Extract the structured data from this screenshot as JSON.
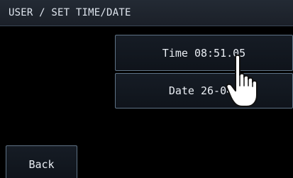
{
  "header": {
    "title": "USER / SET TIME/DATE"
  },
  "buttons": {
    "time_label": "Time 08:51.05",
    "date_label": "Date 26-04-",
    "back_label": "Back"
  },
  "icons": {
    "pointer": "hand-pointer-icon"
  },
  "colors": {
    "background": "#000000",
    "header_bg": "#1e242d",
    "button_border": "#5f7386",
    "text": "#e9edf3"
  }
}
